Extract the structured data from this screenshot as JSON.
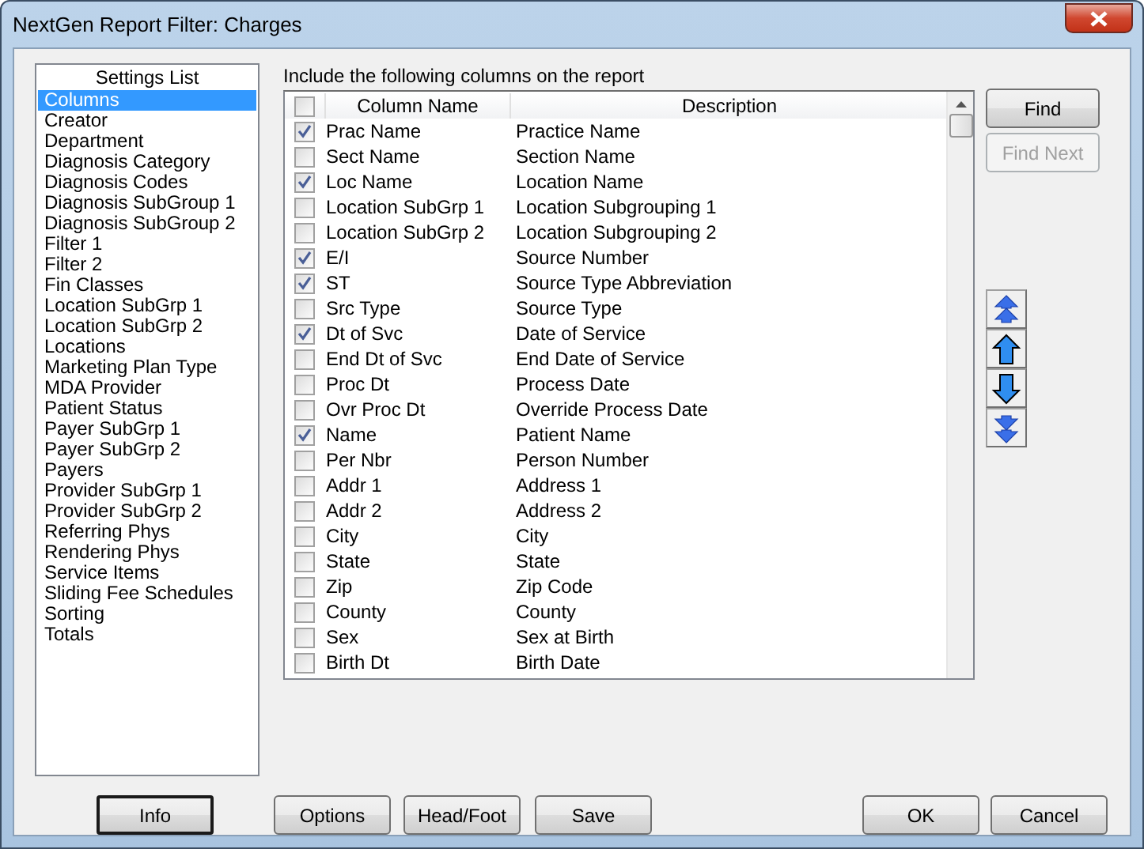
{
  "window": {
    "title": "NextGen Report Filter: Charges"
  },
  "settings_list": {
    "title": "Settings List",
    "items": [
      {
        "label": "Columns",
        "selected": true
      },
      {
        "label": "Creator",
        "selected": false
      },
      {
        "label": "Department",
        "selected": false
      },
      {
        "label": "Diagnosis Category",
        "selected": false
      },
      {
        "label": "Diagnosis Codes",
        "selected": false
      },
      {
        "label": "Diagnosis SubGroup 1",
        "selected": false
      },
      {
        "label": "Diagnosis SubGroup 2",
        "selected": false
      },
      {
        "label": "Filter 1",
        "selected": false
      },
      {
        "label": "Filter 2",
        "selected": false
      },
      {
        "label": "Fin Classes",
        "selected": false
      },
      {
        "label": "Location SubGrp 1",
        "selected": false
      },
      {
        "label": "Location SubGrp 2",
        "selected": false
      },
      {
        "label": "Locations",
        "selected": false
      },
      {
        "label": "Marketing Plan Type",
        "selected": false
      },
      {
        "label": "MDA Provider",
        "selected": false
      },
      {
        "label": "Patient Status",
        "selected": false
      },
      {
        "label": "Payer SubGrp 1",
        "selected": false
      },
      {
        "label": "Payer SubGrp 2",
        "selected": false
      },
      {
        "label": "Payers",
        "selected": false
      },
      {
        "label": "Provider SubGrp 1",
        "selected": false
      },
      {
        "label": "Provider SubGrp 2",
        "selected": false
      },
      {
        "label": "Referring Phys",
        "selected": false
      },
      {
        "label": "Rendering Phys",
        "selected": false
      },
      {
        "label": "Service Items",
        "selected": false
      },
      {
        "label": "Sliding Fee Schedules",
        "selected": false
      },
      {
        "label": "Sorting",
        "selected": false
      },
      {
        "label": "Totals",
        "selected": false
      }
    ]
  },
  "columns_table": {
    "caption": "Include the following columns on the report",
    "select_all_checked": false,
    "columns": [
      "Column Name",
      "Description"
    ],
    "rows": [
      {
        "name": "Prac Name",
        "description": "Practice Name",
        "checked": true
      },
      {
        "name": "Sect Name",
        "description": "Section Name",
        "checked": false
      },
      {
        "name": "Loc Name",
        "description": "Location Name",
        "checked": true
      },
      {
        "name": "Location SubGrp 1",
        "description": "Location Subgrouping 1",
        "checked": false
      },
      {
        "name": "Location SubGrp 2",
        "description": "Location Subgrouping 2",
        "checked": false
      },
      {
        "name": "E/I",
        "description": "Source Number",
        "checked": true
      },
      {
        "name": "ST",
        "description": "Source Type Abbreviation",
        "checked": true
      },
      {
        "name": "Src Type",
        "description": "Source Type",
        "checked": false
      },
      {
        "name": "Dt of Svc",
        "description": "Date of Service",
        "checked": true
      },
      {
        "name": "End Dt of Svc",
        "description": "End Date of Service",
        "checked": false
      },
      {
        "name": "Proc Dt",
        "description": "Process Date",
        "checked": false
      },
      {
        "name": "Ovr Proc Dt",
        "description": "Override Process Date",
        "checked": false
      },
      {
        "name": "Name",
        "description": "Patient Name",
        "checked": true
      },
      {
        "name": "Per Nbr",
        "description": "Person Number",
        "checked": false
      },
      {
        "name": "Addr 1",
        "description": "Address 1",
        "checked": false
      },
      {
        "name": "Addr 2",
        "description": "Address 2",
        "checked": false
      },
      {
        "name": "City",
        "description": "City",
        "checked": false
      },
      {
        "name": "State",
        "description": "State",
        "checked": false
      },
      {
        "name": "Zip",
        "description": "Zip Code",
        "checked": false
      },
      {
        "name": "County",
        "description": "County",
        "checked": false
      },
      {
        "name": "Sex",
        "description": "Sex at Birth",
        "checked": false
      },
      {
        "name": "Birth Dt",
        "description": "Birth Date",
        "checked": false
      }
    ]
  },
  "find_buttons": [
    {
      "label": "Find",
      "disabled": false
    },
    {
      "label": "Find Next",
      "disabled": true
    }
  ],
  "move_buttons": [
    {
      "kind": "top"
    },
    {
      "kind": "up"
    },
    {
      "kind": "down"
    },
    {
      "kind": "bottom"
    }
  ],
  "bottom_buttons": [
    {
      "label": "Info",
      "default": true
    },
    {
      "label": "Options",
      "default": false
    },
    {
      "label": "Head/Foot",
      "default": false
    },
    {
      "label": "Save",
      "default": false
    },
    {
      "label": "OK",
      "default": false
    },
    {
      "label": "Cancel",
      "default": false
    }
  ]
}
